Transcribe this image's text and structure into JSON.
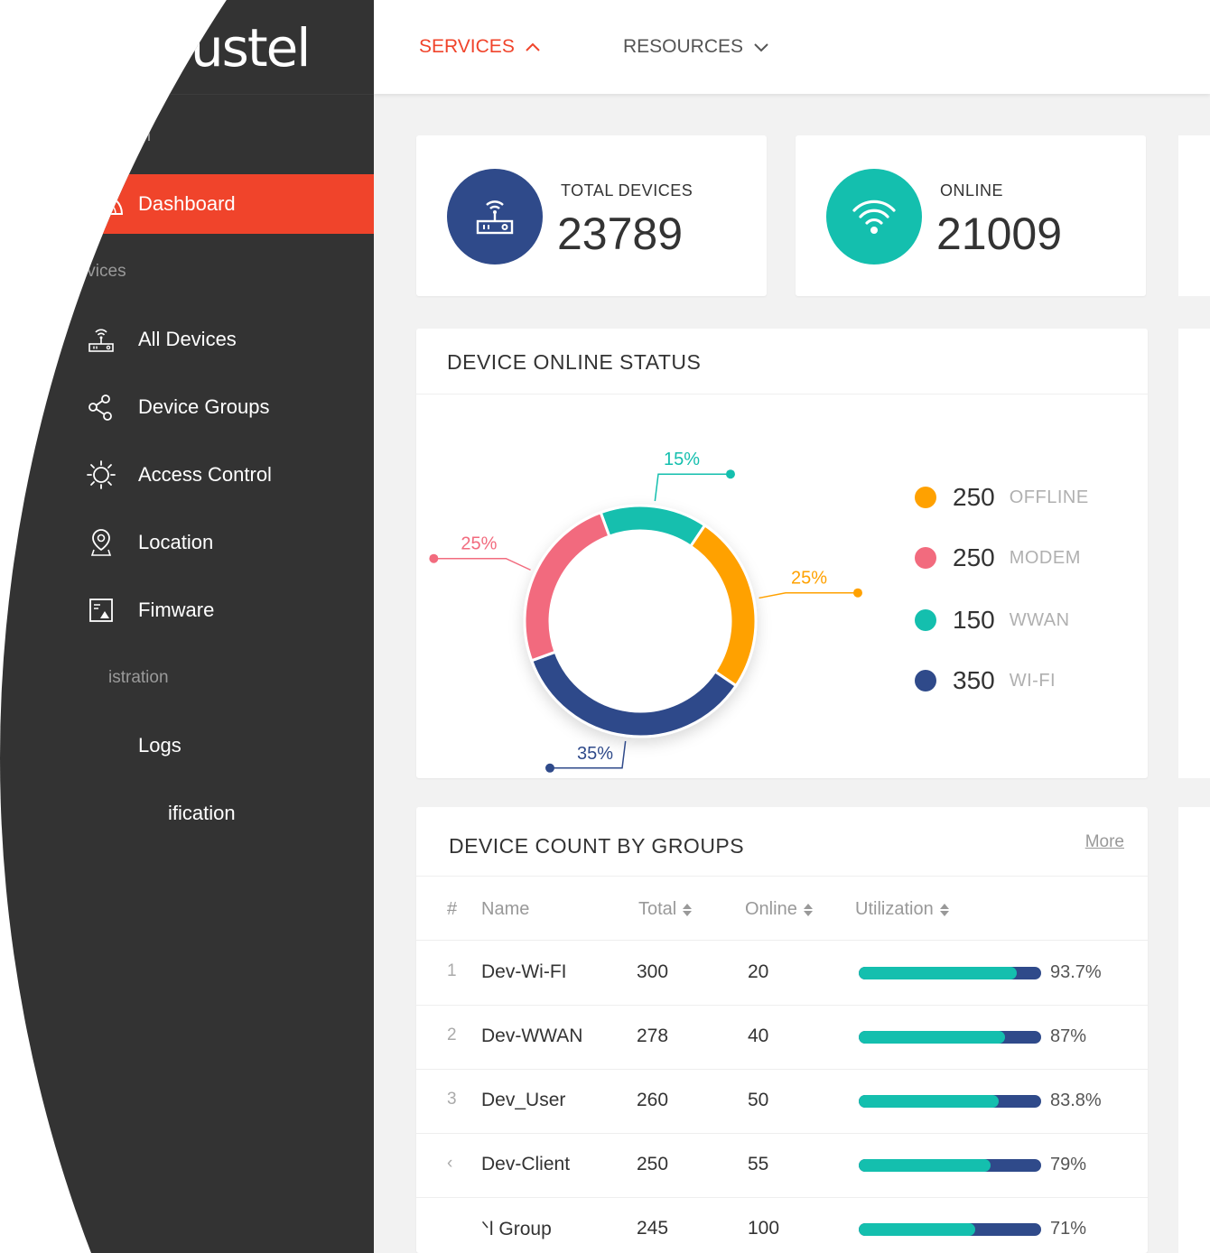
{
  "brand": {
    "name": "robustel"
  },
  "colors": {
    "accent": "#f0442b",
    "sidebar_bg": "#333333",
    "navy": "#2f4a8a",
    "teal": "#14bfae",
    "orange": "#ffa100",
    "pink": "#f26b7e"
  },
  "sidebar": {
    "sections": [
      {
        "label": "Information"
      },
      {
        "label": "Devices"
      },
      {
        "label": "istration"
      }
    ],
    "items": [
      {
        "label": "Dashboard",
        "icon": "gauge-icon",
        "active": true
      },
      {
        "label": "All Devices",
        "icon": "router-icon"
      },
      {
        "label": "Device Groups",
        "icon": "share-nodes-icon"
      },
      {
        "label": "Access Control",
        "icon": "sun-gear-icon"
      },
      {
        "label": "Location",
        "icon": "location-pin-icon"
      },
      {
        "label": "Fimware",
        "icon": "firmware-image-icon"
      },
      {
        "label": "Logs",
        "icon": "logs-icon"
      },
      {
        "label": "ification",
        "icon": "bell-icon"
      }
    ]
  },
  "topnav": {
    "services": "SERVICES",
    "resources": "RESOURCES"
  },
  "stats": {
    "total": {
      "label": "TOTAL DEVICES",
      "value": "23789",
      "icon": "router-icon"
    },
    "online": {
      "label": "ONLINE",
      "value": "21009",
      "icon": "wifi-icon"
    }
  },
  "status_card": {
    "title": "DEVICE ONLINE STATUS",
    "legend": [
      {
        "count": "250",
        "name": "OFFLINE",
        "color": "#ffa100"
      },
      {
        "count": "250",
        "name": "MODEM",
        "color": "#f26b7e"
      },
      {
        "count": "150",
        "name": "WWAN",
        "color": "#14bfae"
      },
      {
        "count": "350",
        "name": "WI-FI",
        "color": "#2f4a8a"
      }
    ]
  },
  "chart_data": {
    "type": "pie",
    "variant": "donut",
    "title": "DEVICE ONLINE STATUS",
    "slices": [
      {
        "name": "WWAN",
        "value": 15,
        "label": "15%",
        "color": "#14bfae"
      },
      {
        "name": "OFFLINE",
        "value": 25,
        "label": "25%",
        "color": "#ffa100"
      },
      {
        "name": "WI-FI",
        "value": 35,
        "label": "35%",
        "color": "#2f4a8a"
      },
      {
        "name": "MODEM",
        "value": 25,
        "label": "25%",
        "color": "#f26b7e"
      }
    ]
  },
  "groups_card": {
    "title": "DEVICE COUNT BY GROUPS",
    "more": "More",
    "columns": {
      "idx": "#",
      "name": "Name",
      "total": "Total",
      "online": "Online",
      "utilization": "Utilization"
    },
    "rows": [
      {
        "idx": "1",
        "name": "Dev-Wi-FI",
        "total": "300",
        "online": "20",
        "utilization": 0.937,
        "pct": "93.7%"
      },
      {
        "idx": "2",
        "name": "Dev-WWAN",
        "total": "278",
        "online": "40",
        "utilization": 0.87,
        "pct": "87%"
      },
      {
        "idx": "3",
        "name": "Dev_User",
        "total": "260",
        "online": "50",
        "utilization": 0.838,
        "pct": "83.8%"
      },
      {
        "idx": "‹",
        "name": "Dev-Client",
        "total": "250",
        "online": "55",
        "utilization": 0.79,
        "pct": "79%"
      },
      {
        "idx": "",
        "name": "ᐠl Group",
        "total": "245",
        "online": "100",
        "utilization": 0.71,
        "pct": "71%"
      }
    ]
  }
}
